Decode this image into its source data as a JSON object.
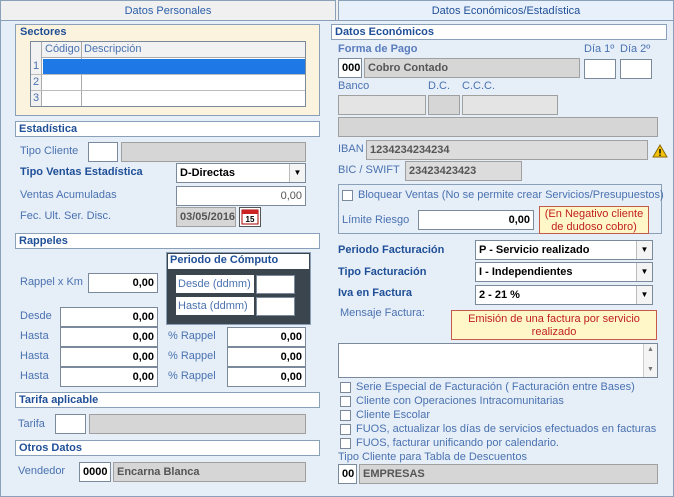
{
  "tabs": [
    {
      "label": "Datos Personales"
    },
    {
      "label": "Datos Económicos/Estadística"
    }
  ],
  "sectores": {
    "title": "Sectores",
    "headers": [
      "Código",
      "Descripción"
    ],
    "rows": [
      {
        "n": "1",
        "codigo": "",
        "descripcion": ""
      },
      {
        "n": "2",
        "codigo": "",
        "descripcion": ""
      },
      {
        "n": "3",
        "codigo": "",
        "descripcion": ""
      }
    ]
  },
  "estadistica": {
    "title": "Estadística",
    "tipo_cliente_label": "Tipo Cliente",
    "tipo_cliente_code": "",
    "tipo_cliente_desc": "",
    "tipo_ventas_label": "Tipo Ventas Estadística",
    "tipo_ventas_value": "D-Directas",
    "ventas_acum_label": "Ventas Acumuladas",
    "ventas_acum_value": "0,00",
    "fec_label": "Fec. Ult. Ser. Disc.",
    "fec_value": "03/05/2016"
  },
  "rappeles": {
    "title": "Rappeles",
    "rappel_km_label": "Rappel x Km",
    "rappel_km_value": "0,00",
    "periodo_title": "Periodo de Cómputo",
    "desde_label": "Desde (ddmm)",
    "hasta_label": "Hasta (ddmm)",
    "desde_value": "",
    "hasta_value": "",
    "desde_row_label": "Desde",
    "desde_row_value": "0,00",
    "hasta_rows": [
      {
        "label": "Hasta",
        "value": "0,00",
        "pct_label": "% Rappel",
        "pct_value": "0,00"
      },
      {
        "label": "Hasta",
        "value": "0,00",
        "pct_label": "% Rappel",
        "pct_value": "0,00"
      },
      {
        "label": "Hasta",
        "value": "0,00",
        "pct_label": "% Rappel",
        "pct_value": "0,00"
      }
    ]
  },
  "tarifa": {
    "title": "Tarifa aplicable",
    "label": "Tarifa",
    "code": "",
    "desc": ""
  },
  "otros": {
    "title": "Otros Datos",
    "vendedor_label": "Vendedor",
    "vendedor_code": "0000",
    "vendedor_name": "Encarna Blanca"
  },
  "economicos": {
    "title": "Datos Económicos",
    "forma_pago_label": "Forma de Pago",
    "dia1_label": "Día 1º",
    "dia2_label": "Día 2º",
    "forma_pago_code": "000",
    "forma_pago_desc": "Cobro Contado",
    "dia1_value": "",
    "dia2_value": "",
    "banco_label": "Banco",
    "dc_label": "D.C.",
    "ccc_label": "C.C.C.",
    "iban_label": "IBAN",
    "iban_value": "1234234234234",
    "bic_label": "BIC / SWIFT",
    "bic_value": "23423423423",
    "bloquear_label": "Bloquear Ventas (No se permite crear Servicios/Presupuestos)",
    "limite_label": "Límite Riesgo",
    "limite_value": "0,00",
    "limite_warning": "(En Negativo cliente de dudoso cobro)",
    "periodo_fact_label": "Periodo Facturación",
    "periodo_fact_value": "P - Servicio realizado",
    "tipo_fact_label": "Tipo Facturación",
    "tipo_fact_value": "I - Independientes",
    "iva_label": "Iva en Factura",
    "iva_value": "2 - 21 %",
    "mensaje_label": "Mensaje Factura:",
    "mensaje_value": "Emisión de una factura por servicio realizado",
    "checks": [
      {
        "label": "Serie Especial de Facturación ( Facturación entre Bases)"
      },
      {
        "label": "Cliente con Operaciones Intracomunitarias"
      },
      {
        "label": "Cliente Escolar"
      },
      {
        "label": "FUOS, actualizar los días de servicios efectuados en facturas"
      },
      {
        "label": "FUOS, facturar unificando por calendario."
      }
    ],
    "tipo_cliente_desc_label": "Tipo Cliente para Tabla de Descuentos",
    "tipo_cliente_desc_code": "00",
    "tipo_cliente_desc_value": "EMPRESAS"
  },
  "colors": {
    "accent": "#1f4f97",
    "label": "#4a72b0",
    "selected_row": "#1e78e6",
    "warning": "#c02020"
  }
}
